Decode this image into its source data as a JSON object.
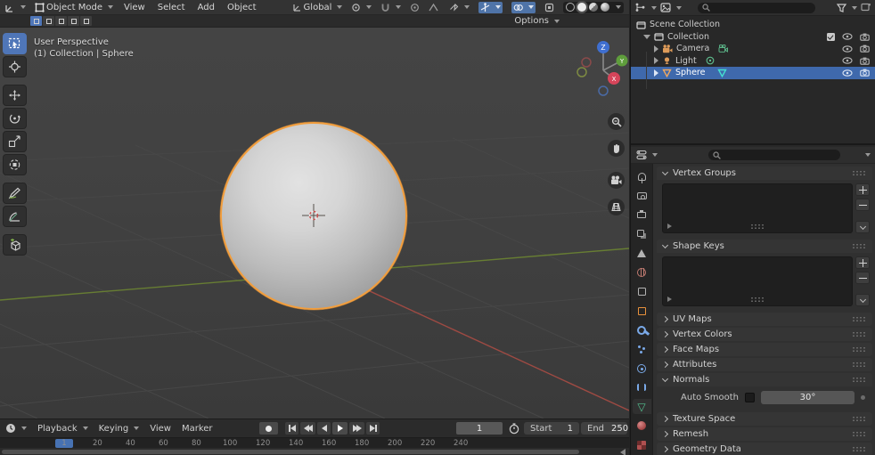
{
  "app": "Blender",
  "viewport": {
    "header": {
      "mode": "Object Mode",
      "menus": [
        "View",
        "Select",
        "Add",
        "Object"
      ],
      "orientation": "Global",
      "options_label": "Options"
    },
    "overlay": {
      "line1": "User Perspective",
      "line2": "(1) Collection | Sphere"
    },
    "toolbar_tools": [
      "select-box",
      "cursor",
      "move",
      "rotate",
      "scale",
      "transform",
      "annotate",
      "measure",
      "add-cube"
    ],
    "nav_gizmo_axes": {
      "x": "X",
      "y": "Y",
      "z": "Z"
    },
    "side_buttons": [
      "zoom",
      "pan",
      "camera-view",
      "toggle-perspective"
    ]
  },
  "outliner": {
    "root_label": "Scene Collection",
    "items": [
      {
        "label": "Collection",
        "selected": false
      },
      {
        "label": "Camera",
        "selected": false
      },
      {
        "label": "Light",
        "selected": false
      },
      {
        "label": "Sphere",
        "selected": true
      }
    ]
  },
  "properties": {
    "tabs": [
      "tool",
      "render",
      "output",
      "view-layer",
      "scene",
      "world",
      "collection",
      "object",
      "modifiers",
      "particles",
      "physics",
      "constraints",
      "object-data",
      "material",
      "texture"
    ],
    "active_tab": "object-data",
    "panels": [
      {
        "label": "Vertex Groups",
        "state": "expanded"
      },
      {
        "label": "Shape Keys",
        "state": "expanded"
      },
      {
        "label": "UV Maps",
        "state": "collapsed"
      },
      {
        "label": "Vertex Colors",
        "state": "collapsed"
      },
      {
        "label": "Face Maps",
        "state": "collapsed"
      },
      {
        "label": "Attributes",
        "state": "collapsed"
      },
      {
        "label": "Normals",
        "state": "expanded"
      },
      {
        "label": "Texture Space",
        "state": "collapsed"
      },
      {
        "label": "Remesh",
        "state": "collapsed"
      },
      {
        "label": "Geometry Data",
        "state": "collapsed"
      }
    ],
    "normals": {
      "auto_smooth_label": "Auto Smooth",
      "auto_smooth_checked": false,
      "angle_value": "30°"
    }
  },
  "timeline": {
    "menus": {
      "playback": "Playback",
      "keying": "Keying",
      "view": "View",
      "marker": "Marker"
    },
    "current_frame": "1",
    "start_label": "Start",
    "start_value": "1",
    "end_label": "End",
    "end_value": "250",
    "first_tick": "1",
    "ticks": [
      "20",
      "40",
      "60",
      "80",
      "100",
      "120",
      "140",
      "160",
      "180",
      "200",
      "220",
      "240"
    ]
  },
  "colors": {
    "selection_blue": "#4772b3",
    "object_orange": "#e8913d",
    "outline_orange": "#f29e3d",
    "data_green": "#54c190",
    "mesh_teal": "#44c0b1",
    "axis_green": "#677d33",
    "axis_red": "#9e4a43"
  }
}
